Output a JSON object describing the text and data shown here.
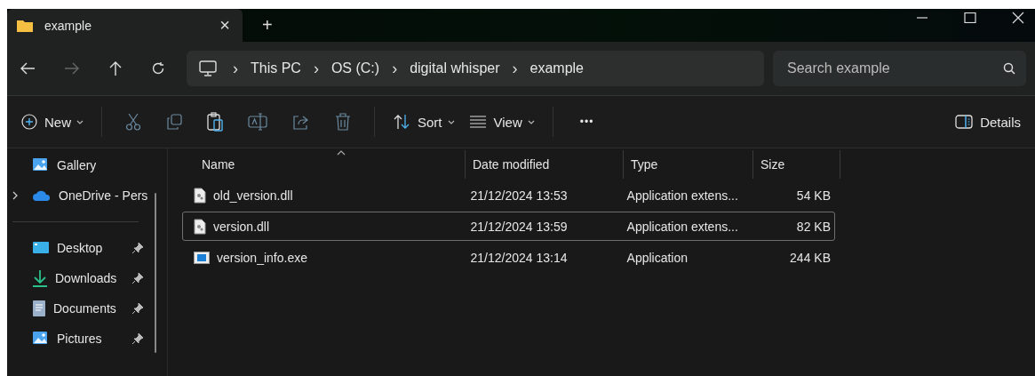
{
  "tab": {
    "title": "example",
    "close": "×",
    "new_tab": "+"
  },
  "address": {
    "segments": [
      "This PC",
      "OS (C:)",
      "digital whisper",
      "example"
    ],
    "separator": "›"
  },
  "search": {
    "placeholder": "Search example"
  },
  "toolbar": {
    "new": "New",
    "sort": "Sort",
    "view": "View",
    "more": "•••",
    "details": "Details"
  },
  "sidebar": {
    "items": [
      {
        "label": "Gallery",
        "kind": "gallery",
        "pinned": false
      },
      {
        "label": "OneDrive - Pers",
        "kind": "cloud",
        "pinned": false,
        "expanded": false
      },
      {
        "label": "Desktop",
        "kind": "desktop",
        "pinned": true
      },
      {
        "label": "Downloads",
        "kind": "download",
        "pinned": true
      },
      {
        "label": "Documents",
        "kind": "document",
        "pinned": true
      },
      {
        "label": "Pictures",
        "kind": "gallery",
        "pinned": true
      }
    ]
  },
  "table": {
    "columns": [
      "Name",
      "Date modified",
      "Type",
      "Size"
    ],
    "rows": [
      {
        "name": "old_version.dll",
        "kind": "dll",
        "date": "21/12/2024 13:53",
        "type": "Application extens...",
        "size": "54 KB",
        "selected": false
      },
      {
        "name": "version.dll",
        "kind": "dll",
        "date": "21/12/2024 13:59",
        "type": "Application extens...",
        "size": "82 KB",
        "selected": true
      },
      {
        "name": "version_info.exe",
        "kind": "exe",
        "date": "21/12/2024 13:14",
        "type": "Application",
        "size": "244 KB",
        "selected": false
      }
    ]
  }
}
